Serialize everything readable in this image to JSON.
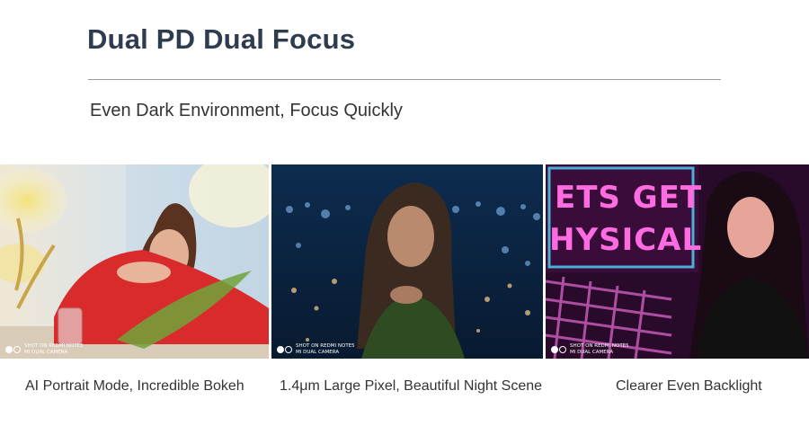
{
  "header": {
    "title": "Dual PD Dual Focus",
    "subtitle": "Even Dark Environment, Focus Quickly"
  },
  "photos": [
    {
      "caption": "AI Portrait Mode, Incredible Bokeh",
      "watermark": {
        "line1": "SHOT ON REDMI NOTE5",
        "line2": "MI DUAL CAMERA"
      }
    },
    {
      "caption": "1.4μm Large Pixel, Beautiful Night Scene",
      "watermark": {
        "line1": "SHOT ON REDMI NOTE5",
        "line2": "MI DUAL CAMERA"
      }
    },
    {
      "caption": "Clearer Even Backlight",
      "watermark": {
        "line1": "SHOT ON REDMI NOTE5",
        "line2": "MI DUAL CAMERA"
      },
      "neon_sign_text": "ETS GET HYSICAL"
    }
  ],
  "colors": {
    "title": "#2f3b4e",
    "text": "#333333",
    "rule": "#9a9a9a",
    "neon_pink": "#ff4fd8",
    "neon_blue": "#4fd8ff"
  }
}
